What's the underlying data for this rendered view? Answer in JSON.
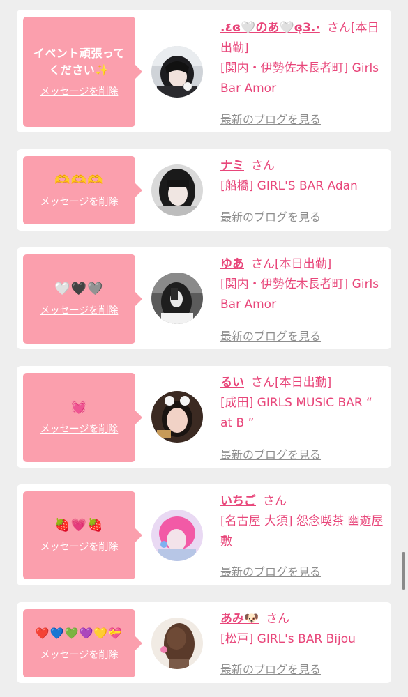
{
  "cards": [
    {
      "message": "イベント頑張って\nください✨",
      "delete_label": "メッセージを削除",
      "name": ".٤ɞ🤍のあ🤍ɞ̨3.·",
      "san": "さん",
      "status": "[本日出勤]",
      "shop": "[関内・伊勢佐木長者町] Girls Bar Amor",
      "blog_label": "最新のブログを見る"
    },
    {
      "message": "🫶🫶🫶",
      "delete_label": "メッセージを削除",
      "name": "ナミ",
      "san": "さん",
      "status": "",
      "shop": "[船橋] GIRL'S BAR Adan",
      "blog_label": "最新のブログを見る"
    },
    {
      "message": "🤍🖤🩶",
      "delete_label": "メッセージを削除",
      "name": "ゆあ",
      "san": "さん",
      "status": "[本日出勤]",
      "shop": "[関内・伊勢佐木長者町] Girls Bar Amor",
      "blog_label": "最新のブログを見る"
    },
    {
      "message": "💓",
      "delete_label": "メッセージを削除",
      "name": "るい",
      "san": "さん",
      "status": "[本日出勤]",
      "shop": "[成田] GIRLS MUSIC BAR “ at B ”",
      "blog_label": "最新のブログを見る"
    },
    {
      "message": "🍓💗🍓",
      "delete_label": "メッセージを削除",
      "name": "いちご",
      "san": "さん",
      "status": "",
      "shop": "[名古屋 大須] 怨念喫茶 幽遊屋敷",
      "blog_label": "最新のブログを見る"
    },
    {
      "message": "❤️💙💚💜💛💝",
      "delete_label": "メッセージを削除",
      "name": "あみ🐶",
      "san": "さん",
      "status": "",
      "shop": "[松戸] GIRL's BAR Bijou",
      "blog_label": "最新のブログを見る"
    }
  ],
  "colors": {
    "bubble": "#fb9fad",
    "accent": "#e8467a",
    "link_gray": "#8e8e8e",
    "background": "#eeeeee"
  }
}
